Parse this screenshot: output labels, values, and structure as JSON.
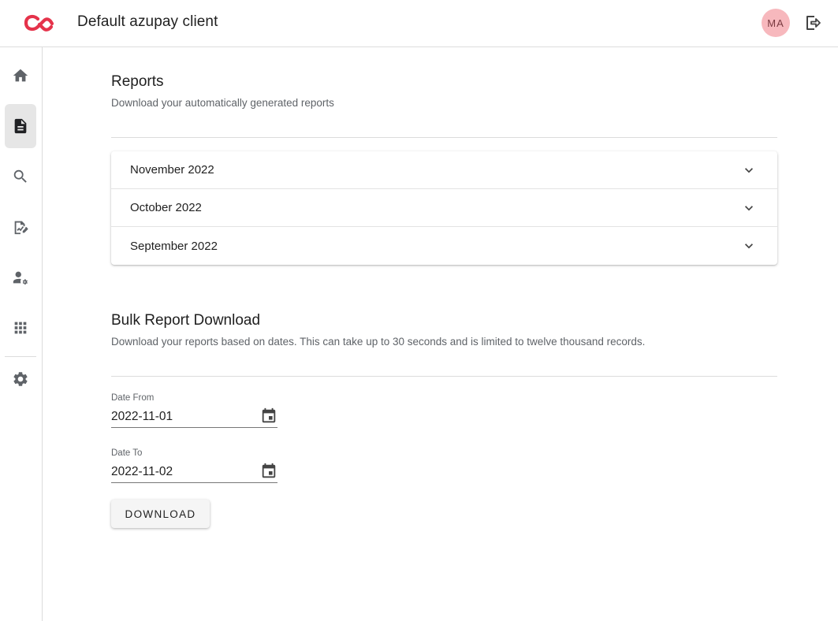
{
  "header": {
    "app_title": "Default azupay client",
    "avatar_initials": "MA",
    "brand_color": "#e5334b",
    "logo_icon": "azupay-logo-icon",
    "logout_icon": "logout-icon"
  },
  "sidebar": {
    "items": [
      {
        "id": "home",
        "icon": "home-icon",
        "active": false
      },
      {
        "id": "reports",
        "icon": "document-icon",
        "active": true
      },
      {
        "id": "search",
        "icon": "search-icon",
        "active": false
      },
      {
        "id": "analytics",
        "icon": "chart-edit-icon",
        "active": false
      },
      {
        "id": "users",
        "icon": "user-settings-icon",
        "active": false
      },
      {
        "id": "apps",
        "icon": "apps-grid-icon",
        "active": false
      },
      {
        "id": "settings",
        "icon": "gear-icon",
        "active": false
      }
    ]
  },
  "reports": {
    "title": "Reports",
    "subtitle": "Download your automatically generated reports",
    "months": [
      {
        "label": "November 2022"
      },
      {
        "label": "October 2022"
      },
      {
        "label": "September 2022"
      }
    ]
  },
  "bulk": {
    "title": "Bulk Report Download",
    "subtitle": "Download your reports based on dates. This can take up to 30 seconds and is limited to twelve thousand records.",
    "date_from": {
      "label": "Date From",
      "value": "2022-11-01"
    },
    "date_to": {
      "label": "Date To",
      "value": "2022-11-02"
    },
    "download_label": "DOWNLOAD"
  }
}
